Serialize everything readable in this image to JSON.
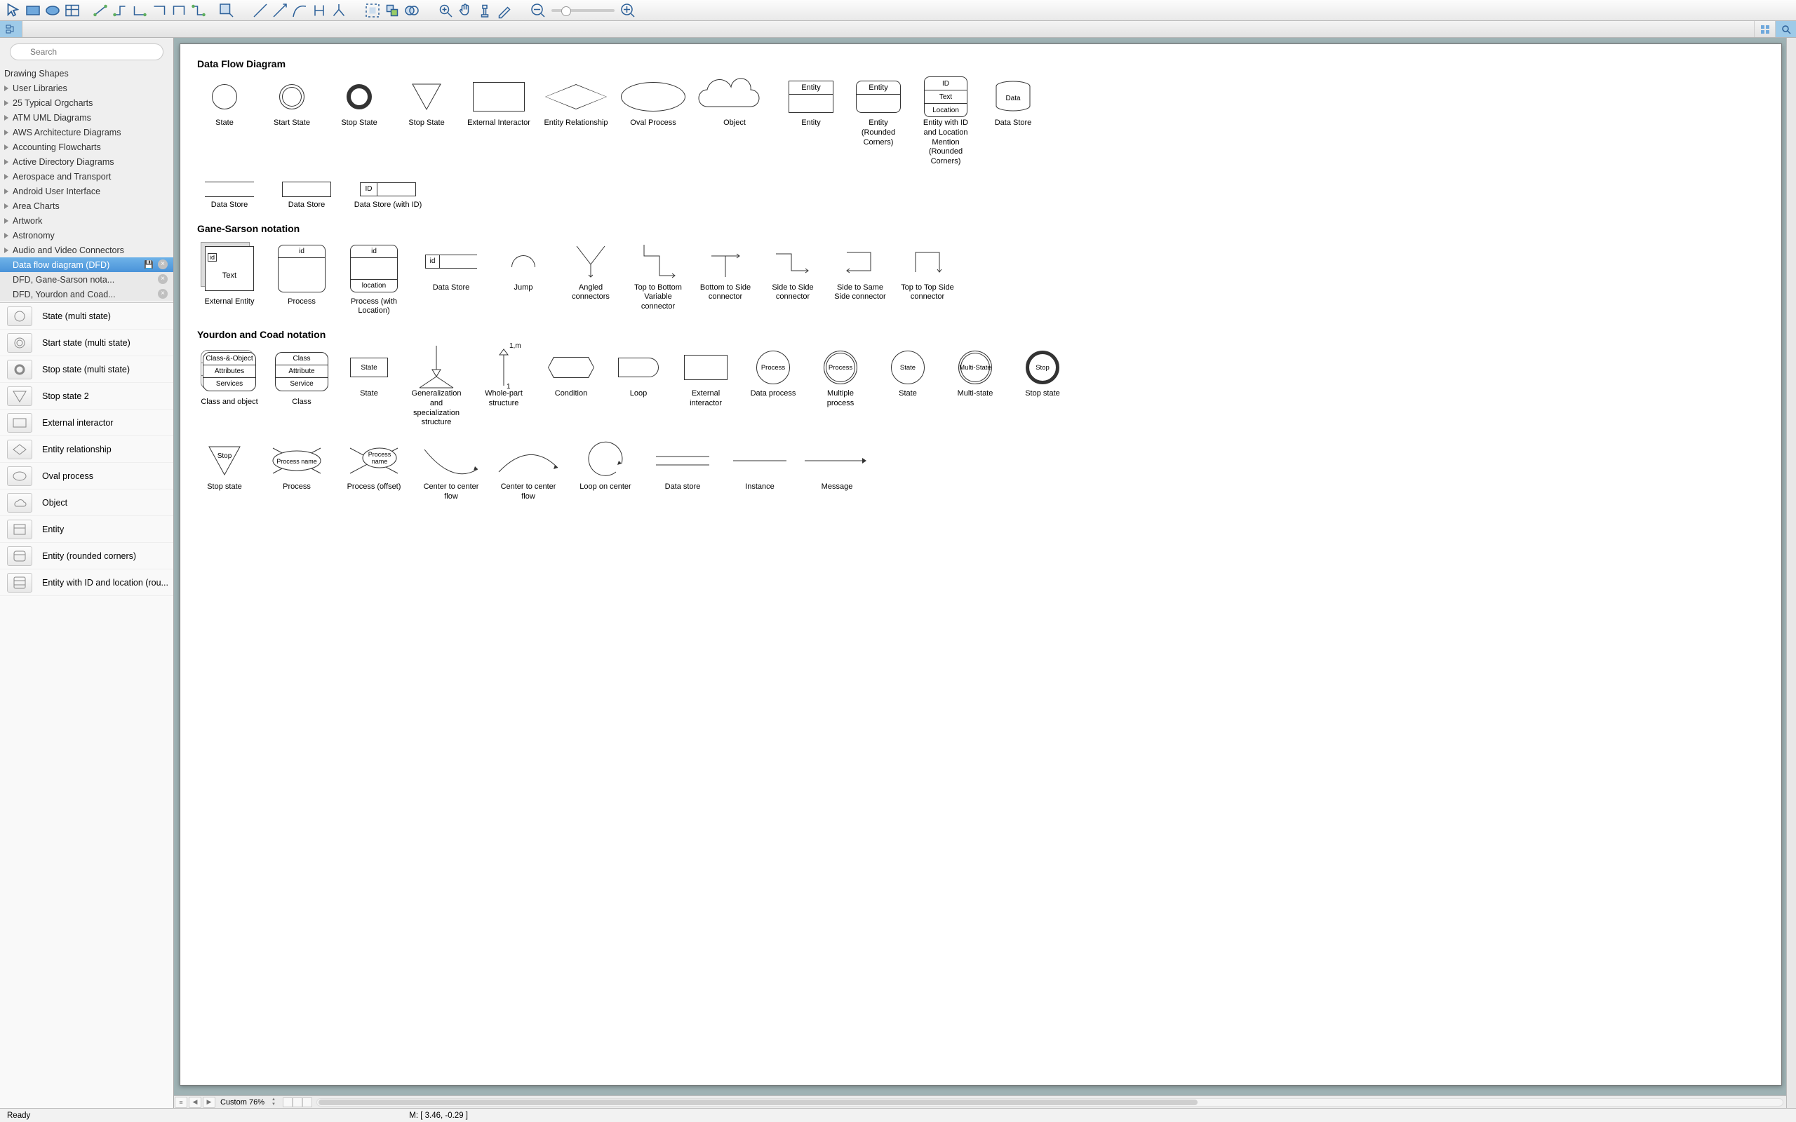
{
  "search": {
    "placeholder": "Search"
  },
  "library_tree": {
    "items": [
      "Drawing Shapes",
      "User Libraries",
      "25 Typical Orgcharts",
      "ATM UML Diagrams",
      "AWS Architecture Diagrams",
      "Accounting Flowcharts",
      "Active Directory Diagrams",
      "Aerospace and Transport",
      "Android User Interface",
      "Area Charts",
      "Artwork",
      "Astronomy",
      "Audio and Video Connectors"
    ],
    "open_group": {
      "title": "Data flow diagram (DFD)",
      "subs": [
        "DFD, Gane-Sarson nota...",
        "DFD, Yourdon and Coad..."
      ]
    }
  },
  "shape_palette": [
    "State (multi state)",
    "Start state (multi state)",
    "Stop state (multi state)",
    "Stop state 2",
    "External interactor",
    "Entity relationship",
    "Oval process",
    "Object",
    "Entity",
    "Entity (rounded corners)",
    "Entity with ID and location (rou..."
  ],
  "canvas": {
    "sections": {
      "dfd": {
        "title": "Data Flow Diagram",
        "row1": [
          "State",
          "Start State",
          "Stop State",
          "Stop State",
          "External Interactor",
          "Entity Relationship",
          "Oval Process",
          "Object",
          "Entity",
          "Entity (Rounded Corners)",
          "Entity with ID and Location Mention (Rounded Corners)",
          "Data Store"
        ],
        "row2": [
          "Data Store",
          "Data Store",
          "Data Store (with ID)"
        ],
        "entity_text": "Entity",
        "id_text": "ID",
        "text_text": "Text",
        "loc_text": "Location",
        "data_text": "Data"
      },
      "gs": {
        "title": "Gane-Sarson notation",
        "labels": [
          "External Entity",
          "Process",
          "Process (with Location)",
          "Data Store",
          "Jump",
          "Angled connectors",
          "Top to Bottom Variable connector",
          "Bottom to Side connector",
          "Side to Side connector",
          "Side to Same Side connector",
          "Top to Top Side connector"
        ],
        "id": "id",
        "text": "Text",
        "location": "location"
      },
      "yc": {
        "title": "Yourdon and Coad notation",
        "row1": [
          "Class and object",
          "Class",
          "State",
          "Generalization and specialization structure",
          "Whole-part structure",
          "Condition",
          "Loop",
          "External interactor",
          "Data process",
          "Multiple process",
          "State",
          "Multi-state",
          "Stop state"
        ],
        "row2": [
          "Stop state",
          "Process",
          "Process (offset)",
          "Center to center flow",
          "Center to center flow",
          "Loop on center",
          "Data store",
          "Instance",
          "Message"
        ],
        "co": "Class-&-Object",
        "attrs": "Attributes",
        "svcs": "Services",
        "class": "Class",
        "attr": "Attribute",
        "svc": "Service",
        "state": "State",
        "onem": "1,m",
        "one": "1",
        "proc": "Process",
        "multi": "Multi-State",
        "stop": "Stop",
        "pname": "Process name"
      }
    }
  },
  "bottombar": {
    "zoom": "Custom 76%"
  },
  "status": {
    "ready": "Ready",
    "coords": "M: [ 3.46, -0.29 ]"
  }
}
